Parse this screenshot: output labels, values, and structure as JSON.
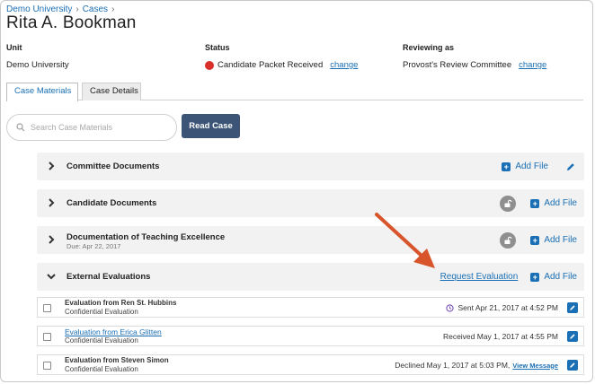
{
  "breadcrumb": {
    "org": "Demo University",
    "cases": "Cases",
    "sep1": "›",
    "sep2": "›"
  },
  "title": "Rita A. Bookman",
  "meta": {
    "unit_label": "Unit",
    "unit_value": "Demo University",
    "status_label": "Status",
    "status_value": "Candidate Packet Received",
    "status_change": "change",
    "status_color": "#d9302c",
    "reviewing_label": "Reviewing as",
    "reviewing_value": "Provost's Review Committee",
    "reviewing_change": "change"
  },
  "tabs": [
    {
      "label": "Case Materials",
      "active": true
    },
    {
      "label": "Case Details",
      "active": false
    }
  ],
  "search": {
    "placeholder": "Search Case Materials"
  },
  "read_case": "Read Case",
  "sections": [
    {
      "title": "Committee Documents",
      "add_file": "Add File",
      "expanded": false
    },
    {
      "title": "Candidate Documents",
      "add_file": "Add File",
      "expanded": false
    },
    {
      "title": "Documentation of Teaching Excellence",
      "subtitle": "Due: Apr 22, 2017",
      "add_file": "Add File",
      "expanded": false
    },
    {
      "title": "External Evaluations",
      "request": "Request Evaluation",
      "add_file": "Add File",
      "expanded": true
    }
  ],
  "evaluations": [
    {
      "name": "Evaluation from Ren St. Hubbins",
      "sub": "Confidential Evaluation",
      "status": "Sent Apr 21, 2017 at 4:52 PM",
      "link": false
    },
    {
      "name": "Evaluation from Erica Glitten",
      "sub": "Confidential Evaluation",
      "status": "Received May 1, 2017 at 4:55 PM",
      "link": true
    },
    {
      "name": "Evaluation from Steven Simon",
      "sub": "Confidential Evaluation",
      "status": "Declined May 1, 2017 at 5:03 PM,",
      "view_message": "View Message",
      "link": false
    }
  ],
  "colors": {
    "accent": "#1a6fb5",
    "button": "#3c5577",
    "annotation_arrow": "#d8542a",
    "section_bg": "#f2f2f2"
  }
}
